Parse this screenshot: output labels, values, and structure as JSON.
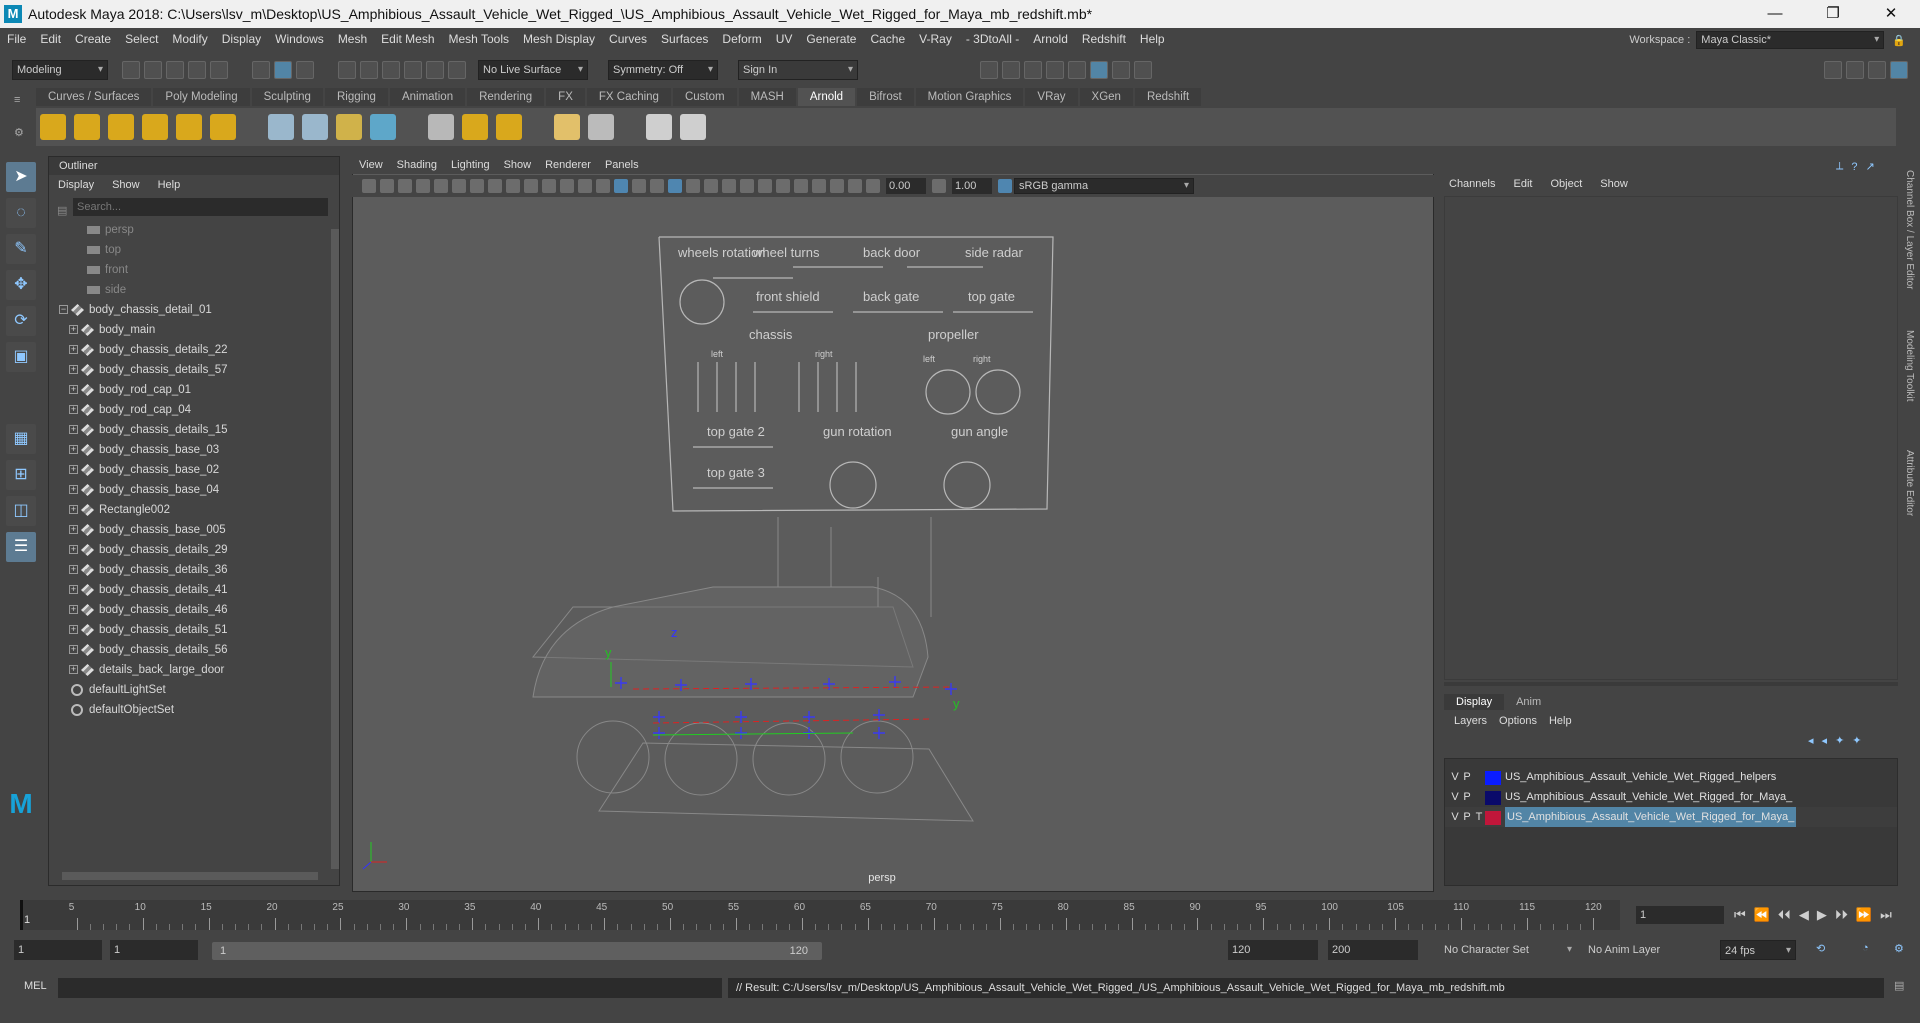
{
  "titlebar": {
    "title": "Autodesk Maya 2018: C:\\Users\\lsv_m\\Desktop\\US_Amphibious_Assault_Vehicle_Wet_Rigged_\\US_Amphibious_Assault_Vehicle_Wet_Rigged_for_Maya_mb_redshift.mb*",
    "logo": "M",
    "minimize": "—",
    "restore": "❐",
    "close": "✕"
  },
  "menubar": [
    "File",
    "Edit",
    "Create",
    "Select",
    "Modify",
    "Display",
    "Windows",
    "Mesh",
    "Edit Mesh",
    "Mesh Tools",
    "Mesh Display",
    "Curves",
    "Surfaces",
    "Deform",
    "UV",
    "Generate",
    "Cache",
    "V-Ray",
    "- 3DtoAll -",
    "Arnold",
    "Redshift",
    "Help"
  ],
  "workspace": {
    "label": "Workspace :",
    "value": "Maya Classic*"
  },
  "statusline": {
    "mode": "Modeling",
    "live_surface": "No Live Surface",
    "symmetry": "Symmetry: Off",
    "sign_in": "Sign In"
  },
  "shelf_tabs": [
    "Curves / Surfaces",
    "Poly Modeling",
    "Sculpting",
    "Rigging",
    "Animation",
    "Rendering",
    "FX",
    "FX Caching",
    "Custom",
    "MASH",
    "Arnold",
    "Bifrost",
    "Motion Graphics",
    "VRay",
    "XGen",
    "Redshift"
  ],
  "shelf_active": "Arnold",
  "outliner": {
    "title": "Outliner",
    "menus": [
      "Display",
      "Show",
      "Help"
    ],
    "search_placeholder": "Search...",
    "items": [
      {
        "label": "persp",
        "type": "camera",
        "indent": 1,
        "dim": true,
        "expander": ""
      },
      {
        "label": "top",
        "type": "camera",
        "indent": 1,
        "dim": true,
        "expander": ""
      },
      {
        "label": "front",
        "type": "camera",
        "indent": 1,
        "dim": true,
        "expander": ""
      },
      {
        "label": "side",
        "type": "camera",
        "indent": 1,
        "dim": true,
        "expander": ""
      },
      {
        "label": "body_chassis_detail_01",
        "type": "mesh",
        "indent": 0,
        "dim": false,
        "expander": "−"
      },
      {
        "label": "body_main",
        "type": "mesh",
        "indent": 1,
        "dim": false,
        "expander": "+"
      },
      {
        "label": "body_chassis_details_22",
        "type": "mesh",
        "indent": 1,
        "dim": false,
        "expander": "+"
      },
      {
        "label": "body_chassis_details_57",
        "type": "mesh",
        "indent": 1,
        "dim": false,
        "expander": "+"
      },
      {
        "label": "body_rod_cap_01",
        "type": "mesh",
        "indent": 1,
        "dim": false,
        "expander": "+"
      },
      {
        "label": "body_rod_cap_04",
        "type": "mesh",
        "indent": 1,
        "dim": false,
        "expander": "+"
      },
      {
        "label": "body_chassis_details_15",
        "type": "mesh",
        "indent": 1,
        "dim": false,
        "expander": "+"
      },
      {
        "label": "body_chassis_base_03",
        "type": "mesh",
        "indent": 1,
        "dim": false,
        "expander": "+"
      },
      {
        "label": "body_chassis_base_02",
        "type": "mesh",
        "indent": 1,
        "dim": false,
        "expander": "+"
      },
      {
        "label": "body_chassis_base_04",
        "type": "mesh",
        "indent": 1,
        "dim": false,
        "expander": "+"
      },
      {
        "label": "Rectangle002",
        "type": "mesh",
        "indent": 1,
        "dim": false,
        "expander": "+"
      },
      {
        "label": "body_chassis_base_005",
        "type": "mesh",
        "indent": 1,
        "dim": false,
        "expander": "+"
      },
      {
        "label": "body_chassis_details_29",
        "type": "mesh",
        "indent": 1,
        "dim": false,
        "expander": "+"
      },
      {
        "label": "body_chassis_details_36",
        "type": "mesh",
        "indent": 1,
        "dim": false,
        "expander": "+"
      },
      {
        "label": "body_chassis_details_41",
        "type": "mesh",
        "indent": 1,
        "dim": false,
        "expander": "+"
      },
      {
        "label": "body_chassis_details_46",
        "type": "mesh",
        "indent": 1,
        "dim": false,
        "expander": "+"
      },
      {
        "label": "body_chassis_details_51",
        "type": "mesh",
        "indent": 1,
        "dim": false,
        "expander": "+"
      },
      {
        "label": "body_chassis_details_56",
        "type": "mesh",
        "indent": 1,
        "dim": false,
        "expander": "+"
      },
      {
        "label": "details_back_large_door",
        "type": "mesh",
        "indent": 1,
        "dim": false,
        "expander": "+"
      },
      {
        "label": "defaultLightSet",
        "type": "set",
        "indent": 0,
        "dim": false,
        "expander": ""
      },
      {
        "label": "defaultObjectSet",
        "type": "set",
        "indent": 0,
        "dim": false,
        "expander": ""
      }
    ]
  },
  "viewport": {
    "menus": [
      "View",
      "Shading",
      "Lighting",
      "Show",
      "Renderer",
      "Panels"
    ],
    "exposure": "0.00",
    "gamma": "1.00",
    "color_space": "sRGB gamma",
    "camera": "persp",
    "rig_panel": {
      "labels": [
        "wheels rotation",
        "wheel turns",
        "back door",
        "side radar",
        "front shield",
        "back gate",
        "top gate",
        "chassis",
        "left",
        "right",
        "propeller",
        "left",
        "right",
        "top gate 2",
        "gun rotation",
        "gun angle",
        "top gate 3"
      ]
    },
    "axis_labels": [
      "y",
      "z",
      "y"
    ]
  },
  "channelbox": {
    "menus": [
      "Channels",
      "Edit",
      "Object",
      "Show"
    ],
    "tabs": [
      "Display",
      "Anim"
    ],
    "layer_menus": [
      "Layers",
      "Options",
      "Help"
    ],
    "layers": [
      {
        "v": "V",
        "p": "P",
        "t": "",
        "color": "#0a1cff",
        "name": "US_Amphibious_Assault_Vehicle_Wet_Rigged_helpers",
        "selected": false
      },
      {
        "v": "V",
        "p": "P",
        "t": "",
        "color": "#0a0a6a",
        "name": "US_Amphibious_Assault_Vehicle_Wet_Rigged_for_Maya_",
        "selected": false
      },
      {
        "v": "V",
        "p": "P",
        "t": "T",
        "color": "#c0163a",
        "name": "US_Amphibious_Assault_Vehicle_Wet_Rigged_for_Maya_",
        "selected": true
      }
    ]
  },
  "right_tabs": [
    "Channel Box / Layer Editor",
    "Modeling Toolkit",
    "Attribute Editor"
  ],
  "timeline": {
    "ticks": [
      "5",
      "10",
      "15",
      "20",
      "25",
      "30",
      "35",
      "40",
      "45",
      "50",
      "55",
      "60",
      "65",
      "70",
      "75",
      "80",
      "85",
      "90",
      "95",
      "100",
      "105",
      "110",
      "115",
      "120"
    ],
    "start_tick": "1",
    "current_frame": "1",
    "playback": [
      "⏮",
      "⏪",
      "⏴⏴",
      "◀",
      "▶",
      "⏵⏵",
      "⏩",
      "⏭"
    ]
  },
  "range": {
    "start": "1",
    "anim_start": "1",
    "range_start": "1",
    "range_end": "120",
    "anim_end": "120",
    "end": "200",
    "character_set": "No Character Set",
    "anim_layer": "No Anim Layer",
    "fps": "24 fps"
  },
  "command": {
    "label": "MEL",
    "result": "// Result: C:/Users/lsv_m/Desktop/US_Amphibious_Assault_Vehicle_Wet_Rigged_/US_Amphibious_Assault_Vehicle_Wet_Rigged_for_Maya_mb_redshift.mb"
  }
}
